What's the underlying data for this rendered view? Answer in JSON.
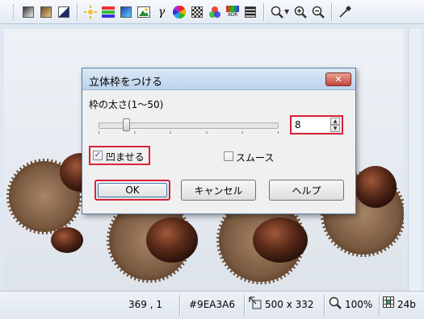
{
  "toolbar": {
    "icons": [
      "grayscale-icon",
      "sepia-icon",
      "negative-icon",
      "brightness-contrast-icon",
      "color-balance-icon",
      "hue-icon",
      "picture-icon",
      "gamma-icon",
      "color-wheel-icon",
      "checker-icon",
      "rgb-icon",
      "xor-icon",
      "stripes-icon"
    ],
    "xor_text": "XOR"
  },
  "dialog": {
    "title": "立体枠をつける",
    "close_glyph": "✕",
    "thickness_label": "枠の太さ(1〜50)",
    "thickness_value": "8",
    "thickness_min": 1,
    "thickness_max": 50,
    "emboss_label": "凹ませる",
    "emboss_checked": true,
    "smooth_label": "スムース",
    "smooth_checked": false,
    "ok_label": "OK",
    "cancel_label": "キャンセル",
    "help_label": "ヘルプ"
  },
  "statusbar": {
    "coords": "369 , 1",
    "color": "#9EA3A6",
    "size": "500 x 332",
    "zoom": "100%",
    "depth": "24b"
  },
  "colors": {
    "highlight": "#d8213a",
    "close_button": "#c1453a"
  }
}
